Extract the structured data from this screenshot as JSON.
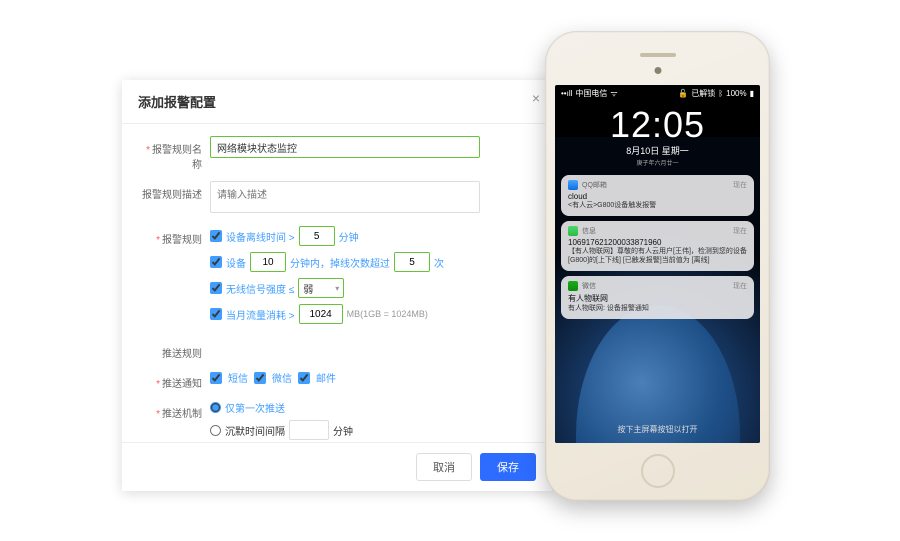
{
  "modal": {
    "title": "添加报警配置",
    "labels": {
      "name": "报警规则名称",
      "desc": "报警规则描述",
      "rules": "报警规则",
      "push": "推送规则",
      "pushNotify": "推送通知",
      "pushMech": "推送机制"
    },
    "name_value": "网络模块状态监控",
    "desc_placeholder": "请输入描述",
    "rule1": {
      "label": "设备离线时间 >",
      "value": "5",
      "unit": "分钟"
    },
    "rule2": {
      "label": "设备",
      "value": "10",
      "mid": "分钟内，掉线次数超过",
      "value2": "5",
      "unit": "次"
    },
    "rule3": {
      "label": "无线信号强度 ≤",
      "value": "弱"
    },
    "rule4": {
      "label": "当月流量消耗 >",
      "value": "1024",
      "unit": "MB(1GB = 1024MB)"
    },
    "push": {
      "sms": "短信",
      "wechat": "微信",
      "email": "邮件"
    },
    "mech": {
      "once": "仅第一次推送",
      "silent": "沉默时间间隔",
      "unit": "分钟"
    },
    "cancel": "取消",
    "save": "保存"
  },
  "phone": {
    "carrier": "中国电信",
    "locked": "已解锁",
    "battery": "100%",
    "time": "12:05",
    "date": "8月10日 星期一",
    "sub": "庚子年六月廿一",
    "notif1": {
      "app": "QQ邮箱",
      "when": "现在",
      "title": "cloud",
      "body": "<有人云>G800设备触发报警"
    },
    "notif2": {
      "app": "信息",
      "when": "现在",
      "title": "106917621200033871960",
      "body": "【有人物联网】尊敬的有人云用户[王伟]，检测到您的设备[G800]的[上下线] [已触发报警]当前值为 [离线]"
    },
    "notif3": {
      "app": "微信",
      "when": "现在",
      "title": "有人物联网",
      "body": "有人物联网: 设备报警通知"
    },
    "swipe": "按下主屏幕按钮以打开"
  }
}
